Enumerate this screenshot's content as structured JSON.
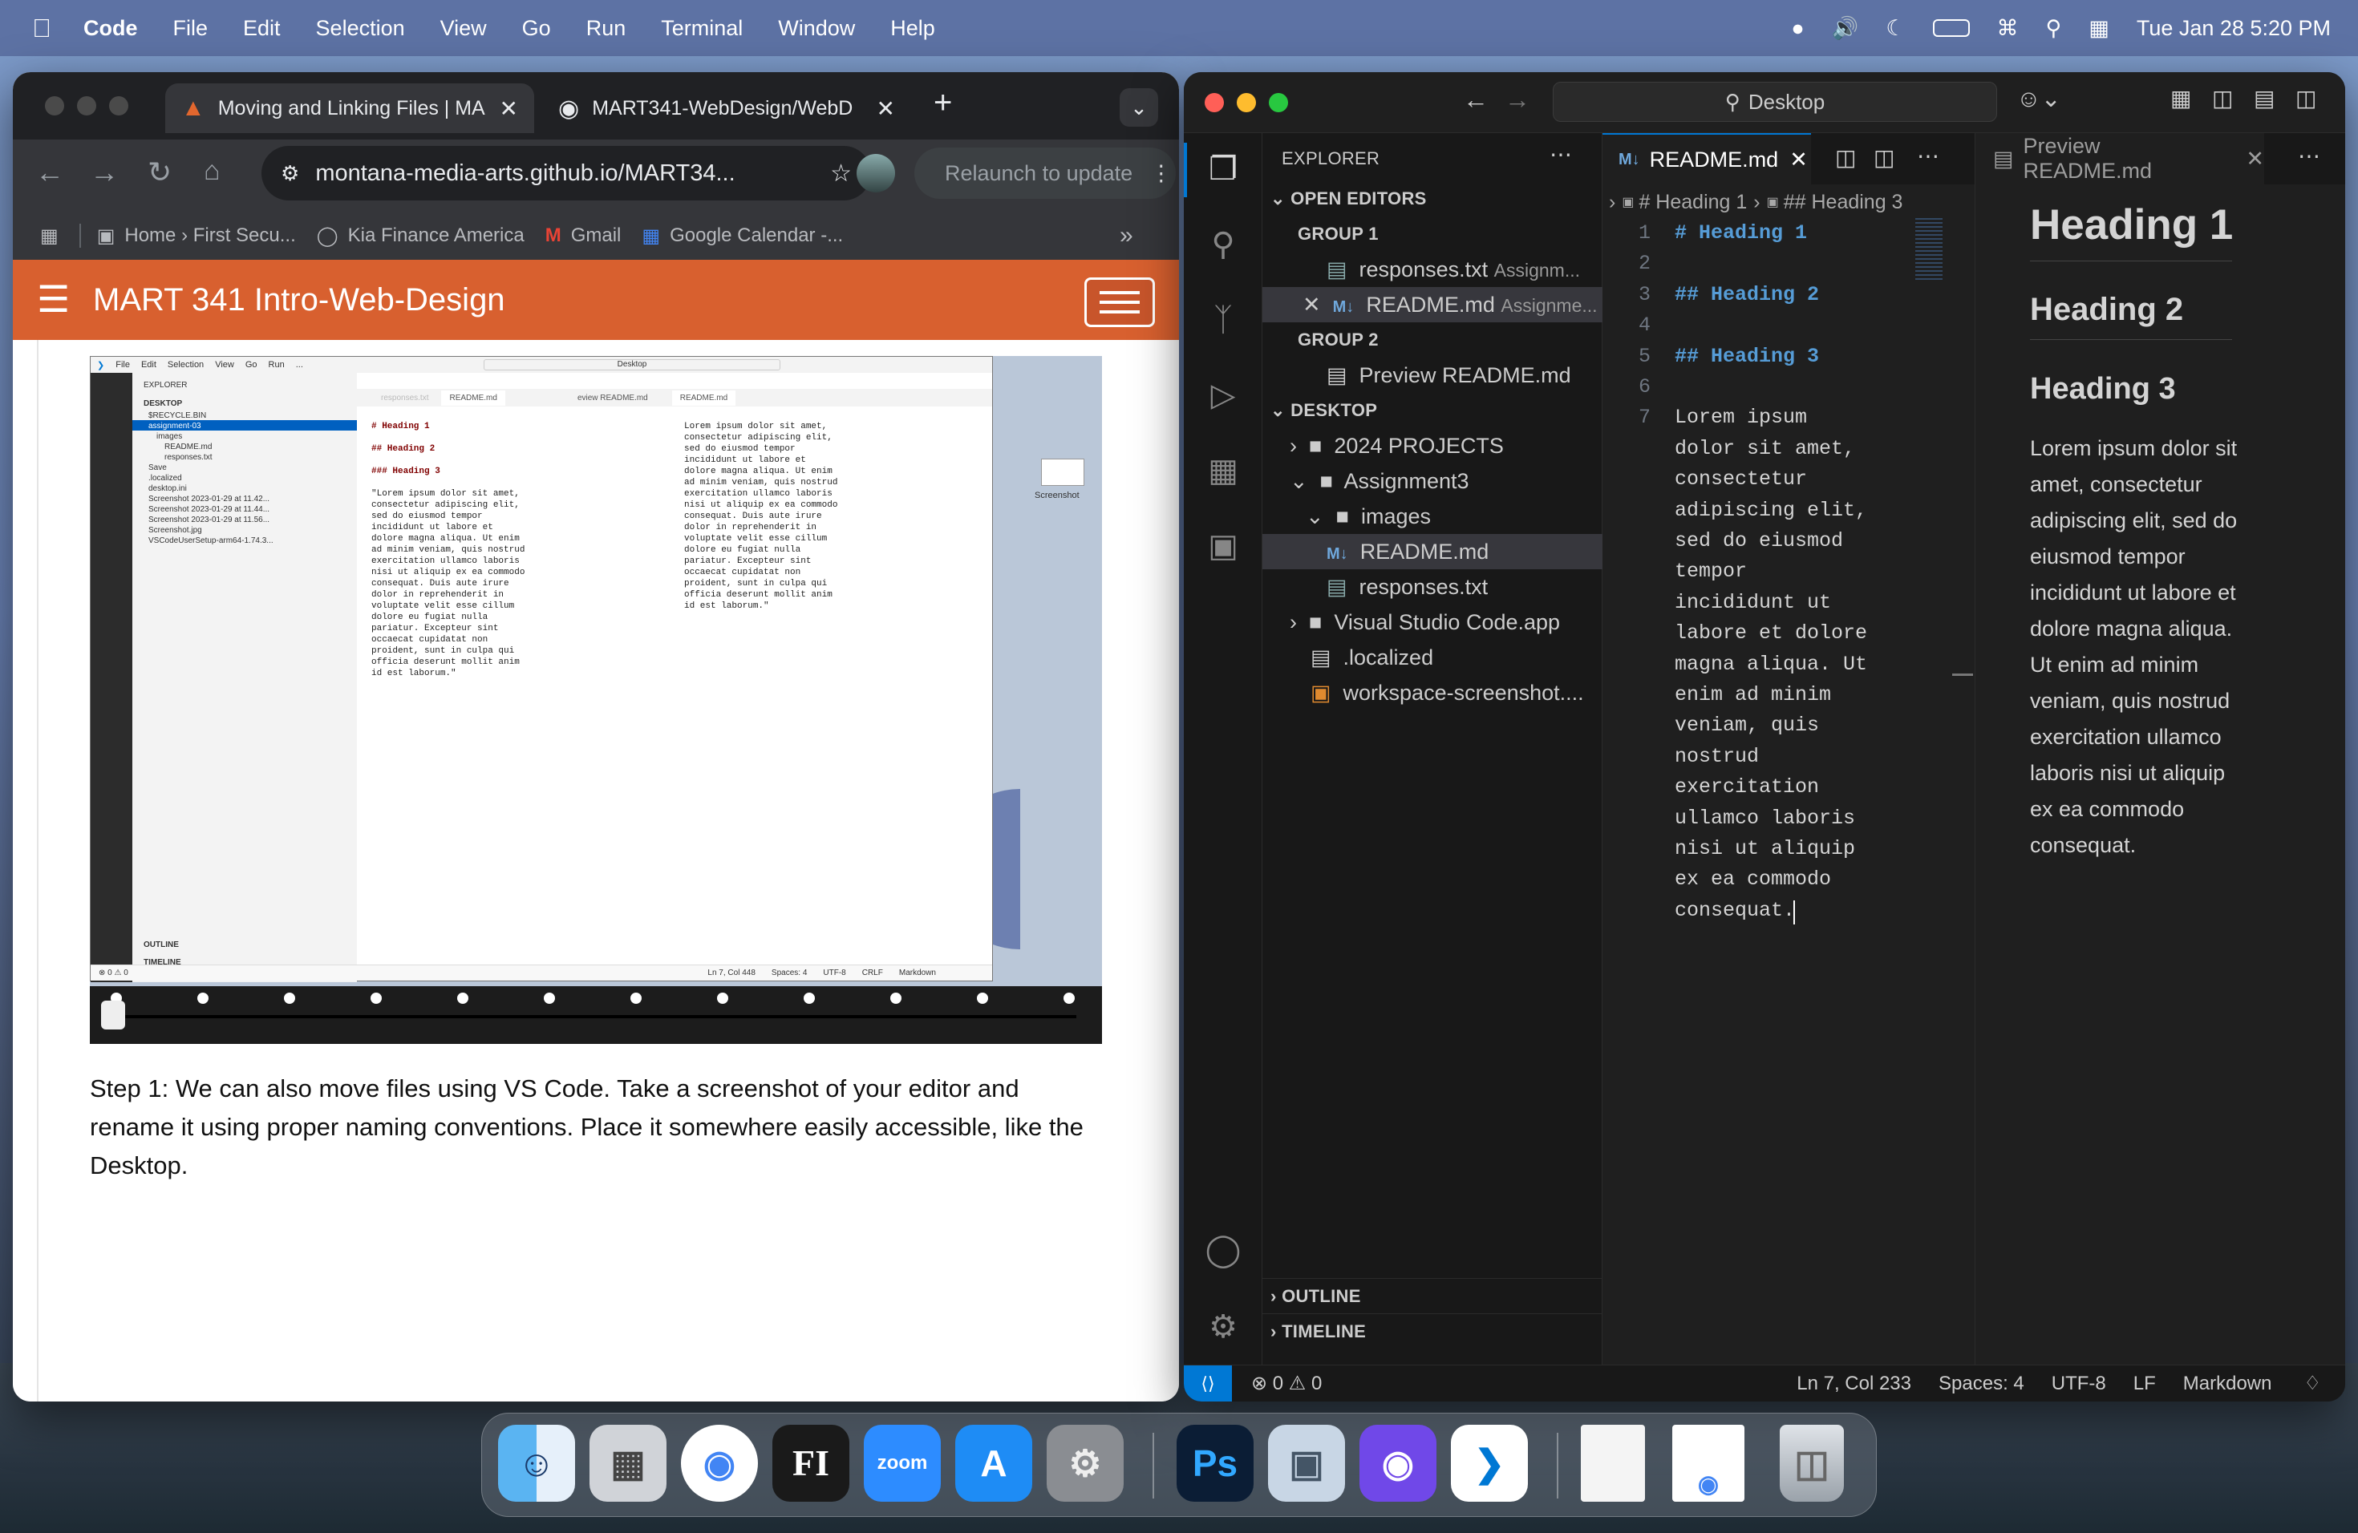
{
  "menubar": {
    "app": "Code",
    "items": [
      "File",
      "Edit",
      "Selection",
      "View",
      "Go",
      "Run",
      "Terminal",
      "Window",
      "Help"
    ],
    "clock": "Tue Jan 28  5:20 PM"
  },
  "chrome": {
    "tabs": [
      {
        "title": "Moving and Linking Files | MA"
      },
      {
        "title": "MART341-WebDesign/WebD"
      }
    ],
    "url": "montana-media-arts.github.io/MART34...",
    "relaunch_label": "Relaunch to update",
    "bookmarks": [
      "Home › First Secu...",
      "Kia Finance America",
      "Gmail",
      "Google Calendar -..."
    ],
    "site_title": "MART 341 Intro-Web-Design",
    "step_text": "Step 1: We can also move files using VS Code. Take a screenshot of your editor and rename it using proper naming conventions. Place it somewhere easily accessible, like the Desktop."
  },
  "embedded": {
    "menu": [
      "File",
      "Edit",
      "Selection",
      "View",
      "Go",
      "Run",
      "..."
    ],
    "search": "Desktop",
    "tabs": [
      "responses.txt",
      "README.md",
      "eview README.md",
      "README.md"
    ],
    "explorer_label": "EXPLORER",
    "desktop_label": "DESKTOP",
    "tree": [
      "$RECYCLE.BIN",
      "assignment-03",
      "images",
      "README.md",
      "responses.txt",
      "Save",
      ".localized",
      "desktop.ini",
      "Screenshot 2023-01-29 at 11.42...",
      "Screenshot 2023-01-29 at 11.44...",
      "Screenshot 2023-01-29 at 11.56...",
      "Screenshot.jpg",
      "VSCodeUserSetup-arm64-1.74.3..."
    ],
    "code_left": [
      "# Heading 1",
      "",
      "## Heading 2",
      "",
      "### Heading 3",
      "",
      "\"Lorem ipsum dolor sit amet,",
      "consectetur adipiscing elit,",
      "sed do eiusmod tempor",
      "incididunt ut labore et",
      "dolore magna aliqua. Ut enim",
      "ad minim veniam, quis nostrud",
      "exercitation ullamco laboris",
      "nisi ut aliquip ex ea commodo",
      "consequat. Duis aute irure",
      "dolor in reprehenderit in",
      "voluptate velit esse cillum",
      "dolore eu fugiat nulla",
      "pariatur. Excepteur sint",
      "occaecat cupidatat non",
      "proident, sunt in culpa qui",
      "officia deserunt mollit anim",
      "id est laborum.\""
    ],
    "code_right": [
      "Lorem ipsum dolor sit amet,",
      "consectetur adipiscing elit,",
      "sed do eiusmod tempor",
      "incididunt ut labore et",
      "dolore magna aliqua. Ut enim",
      "ad minim veniam, quis nostrud",
      "exercitation ullamco laboris",
      "nisi ut aliquip ex ea commodo",
      "consequat. Duis aute irure",
      "dolor in reprehenderit in",
      "voluptate velit esse cillum",
      "dolore eu fugiat nulla",
      "pariatur. Excepteur sint",
      "occaecat cupidatat non",
      "proident, sunt in culpa qui",
      "officia deserunt mollit anim",
      "id est laborum.\""
    ],
    "outline": "OUTLINE",
    "timeline": "TIMELINE",
    "status": [
      "Ln 7, Col 448",
      "Spaces: 4",
      "UTF-8",
      "CRLF",
      "Markdown"
    ],
    "status_left": "⊗ 0 ⚠ 0",
    "desktop_icon_label": "Screenshot"
  },
  "vscode": {
    "search": "Desktop",
    "explorer": "EXPLORER",
    "open_editors": "OPEN EDITORS",
    "group1": "GROUP 1",
    "group2": "GROUP 2",
    "g1_items": [
      {
        "name": "responses.txt",
        "hint": "Assignm..."
      },
      {
        "name": "README.md",
        "hint": "Assignme..."
      }
    ],
    "g2_items": [
      {
        "name": "Preview README.md"
      }
    ],
    "desktop": "DESKTOP",
    "tree": [
      "2024 PROJECTS",
      "Assignment3",
      "images",
      "README.md",
      "responses.txt",
      "Visual Studio Code.app",
      ".localized",
      "workspace-screenshot...."
    ],
    "outline": "OUTLINE",
    "timeline": "TIMELINE",
    "editor_tab": "README.md",
    "preview_tab": "Preview README.md",
    "breadcrumb": [
      "# Heading 1",
      "## Heading 3"
    ],
    "lines": [
      "# Heading 1",
      "",
      "## Heading 2",
      "",
      "## Heading 3",
      "",
      "Lorem ipsum",
      "dolor sit amet,",
      "consectetur",
      "adipiscing elit,",
      "sed do eiusmod",
      "tempor",
      "incididunt ut",
      "labore et dolore",
      "magna aliqua. Ut",
      "enim ad minim",
      "veniam, quis",
      "nostrud",
      "exercitation",
      "ullamco laboris",
      "nisi ut aliquip",
      "ex ea commodo",
      "consequat. "
    ],
    "preview": {
      "h1": "Heading 1",
      "h2": "Heading 2",
      "h3": "Heading 3",
      "para": "Lorem ipsum dolor sit amet, consectetur adipiscing elit, sed do eiusmod tempor incididunt ut labore et dolore magna aliqua. Ut enim ad minim veniam, quis nostrud exercitation ullamco laboris nisi ut aliquip ex ea commodo consequat."
    },
    "status": {
      "problems": "⊗ 0 ⚠ 0",
      "position": "Ln 7, Col 233",
      "spaces": "Spaces: 4",
      "encoding": "UTF-8",
      "eol": "LF",
      "language": "Markdown"
    }
  },
  "dock": [
    "Finder",
    "Launchpad",
    "Google Chrome",
    "FI",
    "zoom",
    "App Store",
    "System Settings",
    "Ps",
    "Preview",
    "GitHub Desktop",
    "Visual Studio Code",
    "Document",
    "Chrome Document",
    "Trash"
  ],
  "colors": {
    "site_orange": "#d8602f",
    "vscode_blue": "#0078d4",
    "heading_blue": "#569cd6"
  }
}
